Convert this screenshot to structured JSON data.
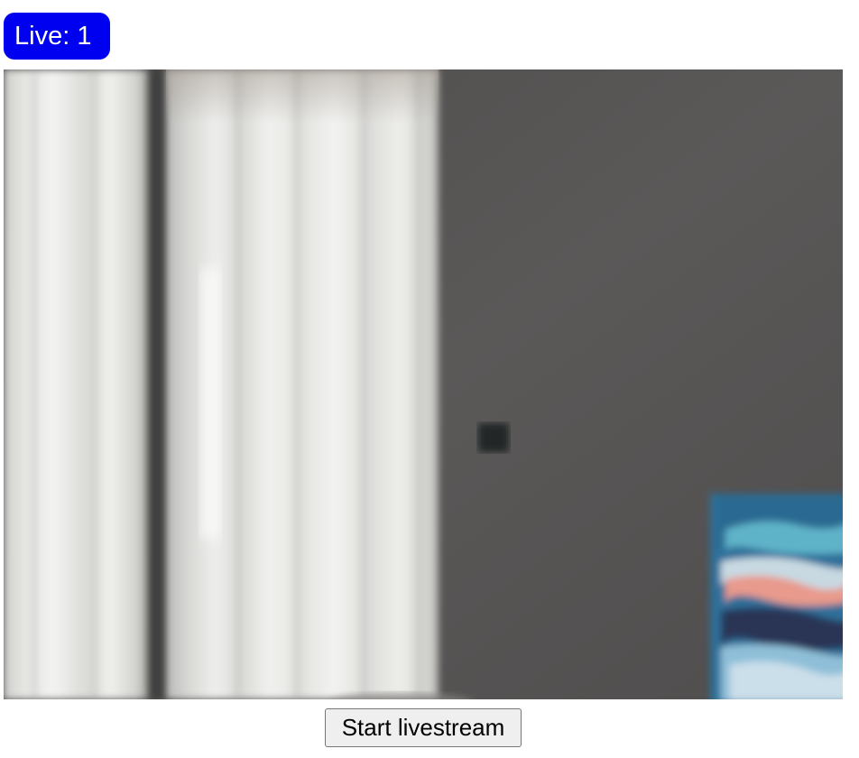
{
  "live_badge": {
    "label": "Live: 1",
    "color": "#0000f0"
  },
  "video": {
    "scene": "webcam-feed"
  },
  "controls": {
    "start_label": "Start livestream"
  }
}
